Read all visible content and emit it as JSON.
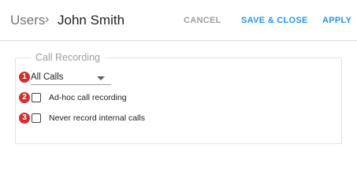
{
  "header": {
    "breadcrumb_root": "Users",
    "breadcrumb_separator": "›",
    "breadcrumb_current": "John Smith",
    "cancel_label": "CANCEL",
    "save_close_label": "SAVE & CLOSE",
    "apply_label": "APPLY"
  },
  "call_recording": {
    "legend": "Call Recording",
    "select": {
      "selected": "All Calls",
      "icon": "caret-down-icon"
    },
    "options": [
      {
        "label": "Ad-hoc call recording",
        "checked": false
      },
      {
        "label": "Never record internal calls",
        "checked": false
      }
    ],
    "badges": [
      "1",
      "2",
      "3"
    ]
  },
  "colors": {
    "accent": "#2196f3",
    "badge": "#d32f2f",
    "muted": "#9e9e9e"
  }
}
